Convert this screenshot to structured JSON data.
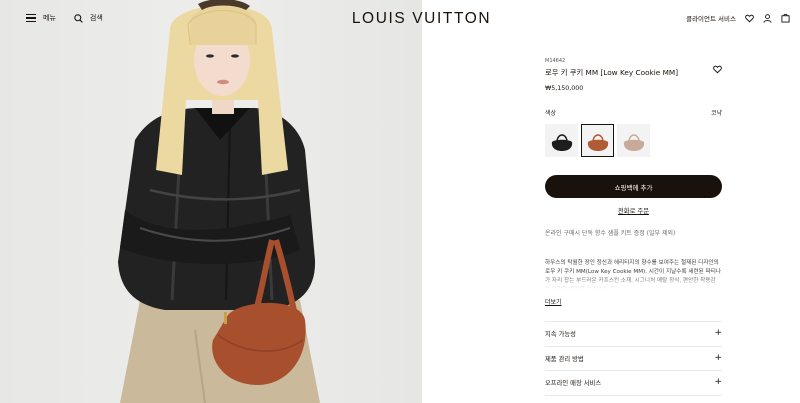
{
  "header": {
    "menu_label": "메뉴",
    "search_label": "검색",
    "brand": "LOUIS VUITTON",
    "client_services": "클라이언트 서비스"
  },
  "product": {
    "sku": "M14642",
    "title": "로우 키 쿠키 MM [Low Key Cookie MM]",
    "price": "₩5,150,000",
    "color_label": "색상",
    "color_value": "코냑",
    "swatches": [
      {
        "name": "black",
        "color": "#1d1d1d"
      },
      {
        "name": "cognac",
        "color": "#b15a36"
      },
      {
        "name": "taupe",
        "color": "#c9a99a"
      }
    ],
    "add_to_bag": "쇼핑백에 추가",
    "order_by_phone": "전화로 주문",
    "notice": "온라인 구매시 단독 향수 샘플 키트 증정 (일부 제외)",
    "description": "하우스의 탁월한 장인 정신과 헤리티지의 향수를 보여주는 절제된 디자인의 로우 키 쿠키 MM(Low Key Cookie MM). 시간이 지날수록 세련된 파티나가 자리 잡는 부드러운 카프스킨 소재, 시그니처 메탈 장식, 편안한 착용감 등 다양한 매력을 갖추었습니다.",
    "read_more": "더보기",
    "accordion": [
      "지속 가능성",
      "제품 관리 방법",
      "오프라인 매장 서비스"
    ]
  },
  "colors": {
    "brand_dark": "#19110b",
    "hair": "#ecd9a2",
    "jacket": "#1f1f1f",
    "bag": "#a84f2d"
  }
}
